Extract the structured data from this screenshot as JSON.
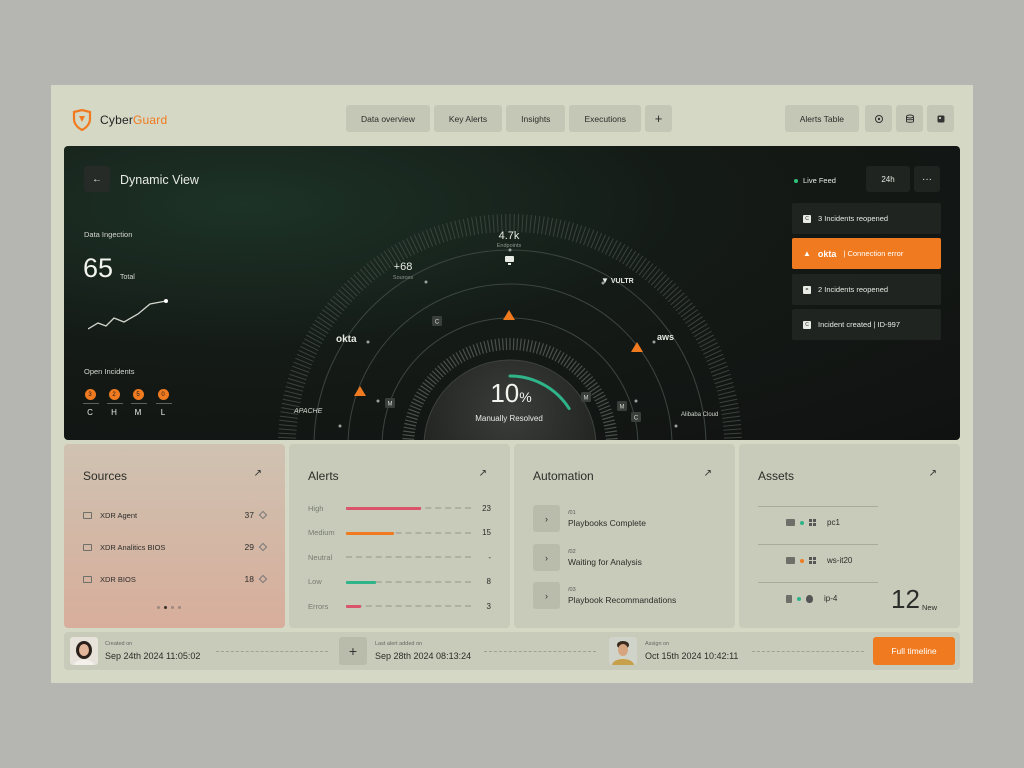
{
  "brand": {
    "prefix": "Cyber",
    "suffix": "Guard"
  },
  "nav": {
    "tabs": [
      "Data overview",
      "Key Alerts",
      "Insights",
      "Executions"
    ],
    "add": "+",
    "alerts_table": "Alerts Table"
  },
  "hero": {
    "title": "Dynamic View",
    "back": "←",
    "ingestion_label": "Data Ingection",
    "total_value": "65",
    "total_label": "Total",
    "open_incidents_label": "Open Incidents",
    "severities": [
      {
        "count": "3",
        "label": "C"
      },
      {
        "count": "2",
        "label": "H"
      },
      {
        "count": "5",
        "label": "M"
      },
      {
        "count": "0",
        "label": "L"
      }
    ],
    "radar": {
      "endpoints_value": "4.7k",
      "endpoints_label": "Endpoints",
      "sources_value": "+68",
      "sources_label": "Sources",
      "resolved_value": "10",
      "resolved_unit": "%",
      "resolved_fraction": 0.1,
      "resolved_label": "Manually Resolved",
      "brands": {
        "okta": "okta",
        "vultr": "VULTR",
        "aws": "aws",
        "apache": "APACHE",
        "alibaba": "Alibaba Cloud"
      },
      "markers": {
        "c": "C",
        "m": "M"
      }
    },
    "live_feed": "Live Feed",
    "range": "24h",
    "more": "···",
    "feed": [
      {
        "text": "3 Incidents reopened",
        "icon": "C"
      },
      {
        "brand": "okta",
        "text": "| Connection error"
      },
      {
        "text": "2 Incidents reopened",
        "icon": "="
      },
      {
        "text": "Incident created | ID-997",
        "icon": "C"
      }
    ]
  },
  "sources": {
    "title": "Sources",
    "arrow": "↗",
    "items": [
      {
        "name": "XDR Agent",
        "count": "37"
      },
      {
        "name": "XDR Analitics BIOS",
        "count": "29"
      },
      {
        "name": "XDR BIOS",
        "count": "18"
      }
    ]
  },
  "alerts": {
    "title": "Alerts",
    "arrow": "↗",
    "rows": [
      {
        "label": "High",
        "value": "23",
        "fraction": 0.6,
        "color": "#d9546a"
      },
      {
        "label": "Medium",
        "value": "15",
        "fraction": 0.38,
        "color": "#f07a1f"
      },
      {
        "label": "Neutral",
        "value": "-",
        "fraction": 0,
        "color": "#888888"
      },
      {
        "label": "Low",
        "value": "8",
        "fraction": 0.24,
        "color": "#2fb389"
      },
      {
        "label": "Errors",
        "value": "3",
        "fraction": 0.12,
        "color": "#d9546a"
      }
    ]
  },
  "automation": {
    "title": "Automation",
    "arrow": "↗",
    "chevron": "›",
    "items": [
      {
        "num": "/01",
        "label": "Playbooks Complete"
      },
      {
        "num": "/02",
        "label": "Waiting for Analysis"
      },
      {
        "num": "/03",
        "label": "Playbook Recommandations"
      }
    ]
  },
  "assets": {
    "title": "Assets",
    "arrow": "↗",
    "items": [
      {
        "name": "pc1",
        "status_color": "#2fb389"
      },
      {
        "name": "ws-it20",
        "status_color": "#f07a1f"
      },
      {
        "name": "ip-4",
        "status_color": "#2fb389"
      }
    ],
    "new_count": "12",
    "new_label": "New"
  },
  "timeline": {
    "created_label": "Created on",
    "created_value": "Sep 24th 2024 11:05:02",
    "plus": "+",
    "last_alert_label": "Last alert added on",
    "last_alert_value": "Sep 28th 2024 08:13:24",
    "assign_label": "Assign on",
    "assign_value": "Oct 15th 2024 10:42:11",
    "button": "Full timeline"
  },
  "colors": {
    "accent": "#f07a1f",
    "hero_bg": "#141a16",
    "panel": "#d5d8c5",
    "success": "#2fb389"
  }
}
